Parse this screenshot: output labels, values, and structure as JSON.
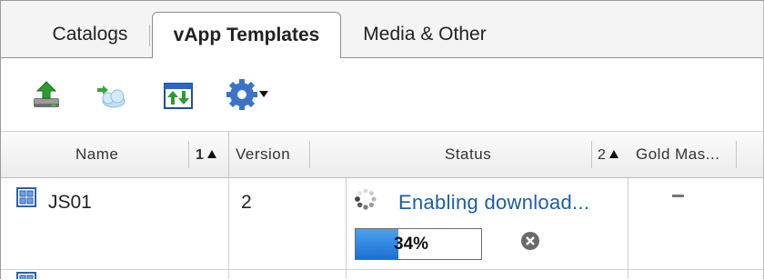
{
  "tabs": [
    {
      "label": "Catalogs",
      "active": false
    },
    {
      "label": "vApp Templates",
      "active": true
    },
    {
      "label": "Media & Other",
      "active": false
    }
  ],
  "toolbar": {
    "icons": [
      "upload-icon",
      "add-to-cloud-icon",
      "sync-icon",
      "gear-actions-icon"
    ]
  },
  "grid": {
    "columns": [
      {
        "label": "Name",
        "sort_order": "1",
        "sort_dir": "asc"
      },
      {
        "label": "Version"
      },
      {
        "label": "Status",
        "sort_order": "2",
        "sort_dir": "asc"
      },
      {
        "label": "Gold Mas..."
      }
    ],
    "rows": [
      {
        "name": "JS01",
        "version": "2",
        "status": "Enabling download...",
        "progress_label": "34%",
        "progress": 0.34,
        "gold_master": "–"
      }
    ]
  },
  "colors": {
    "status_link": "#1a5ea8",
    "progress_fill": "#2a80dc",
    "status_header_highlight": "#c7e3f6"
  }
}
